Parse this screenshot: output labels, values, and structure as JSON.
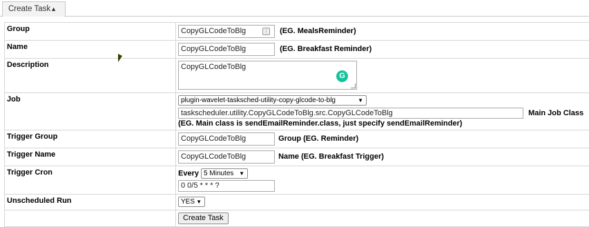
{
  "tab": {
    "label": "Create Task",
    "arrow": "▲"
  },
  "rows": {
    "group": {
      "label": "Group",
      "value": "CopyGLCodeToBlg",
      "hint": "(EG. MealsReminder)"
    },
    "name": {
      "label": "Name",
      "value": "CopyGLCodeToBlg",
      "hint": "(EG. Breakfast Reminder)"
    },
    "description": {
      "label": "Description",
      "value": "CopyGLCodeToBlg"
    },
    "job": {
      "label": "Job",
      "select_value": "plugin-wavelet-tasksched-utility-copy-glcode-to-blg",
      "class_value": "taskscheduler.utility.CopyGLCodeToBlg.src.CopyGLCodeToBlg",
      "class_label": "Main Job Class",
      "hint": "(EG. Main class is sendEmailReminder.class, just specify sendEmailReminder)"
    },
    "trigger_group": {
      "label": "Trigger Group",
      "value": "CopyGLCodeToBlg",
      "hint": "Group (EG. Reminder)"
    },
    "trigger_name": {
      "label": "Trigger Name",
      "value": "CopyGLCodeToBlg",
      "hint": "Name (EG. Breakfast Trigger)"
    },
    "trigger_cron": {
      "label": "Trigger Cron",
      "every_label": "Every",
      "interval_value": "5 Minutes",
      "cron_value": "0 0/5 * * * ?"
    },
    "unscheduled_run": {
      "label": "Unscheduled Run",
      "value": "YES"
    }
  },
  "submit": {
    "label": "Create Task"
  },
  "icons": {
    "grammarly": "grammarly-icon",
    "password_key": "key-icon",
    "dropdown": "chevron-down-icon"
  },
  "colors": {
    "grammarly": "#15c39a",
    "border": "#d6d6d6"
  }
}
